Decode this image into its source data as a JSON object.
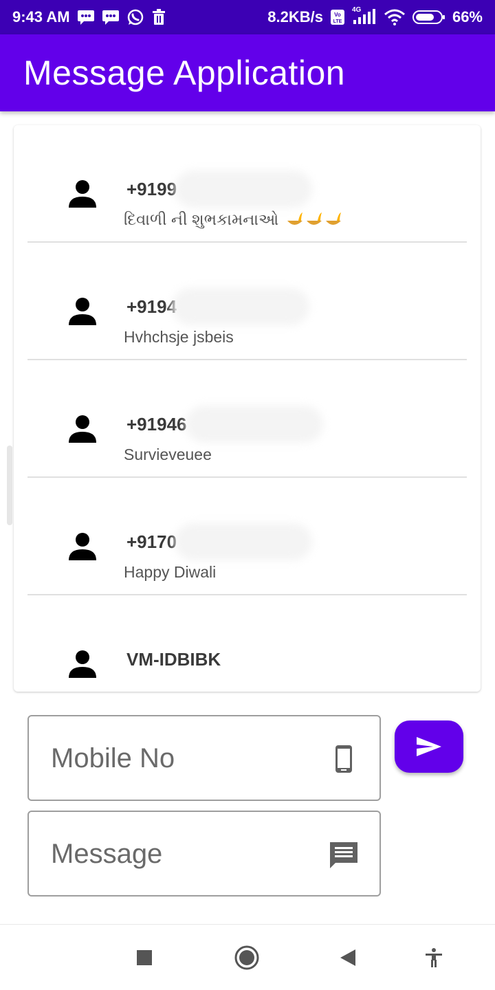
{
  "status_bar": {
    "time": "9:43 AM",
    "speed": "8.2KB/s",
    "network": "4G",
    "battery": "66%",
    "icons": [
      "message-icon",
      "message-icon",
      "whatsapp-icon",
      "trash-icon",
      "volte-icon",
      "signal-icon",
      "wifi-icon",
      "battery-icon"
    ]
  },
  "app_bar": {
    "title": "Message Application"
  },
  "messages": [
    {
      "sender": "+9199",
      "preview": "દિવાળી ની શુભકામનાઓ"
    },
    {
      "sender": "+9194",
      "preview": "Hvhchsje jsbeis"
    },
    {
      "sender": "+91946",
      "preview": "Survieveuee"
    },
    {
      "sender": "+9170",
      "preview": "Happy Diwali"
    },
    {
      "sender": "VM-IDBIBK",
      "preview": ""
    }
  ],
  "form": {
    "mobile_placeholder": "Mobile No",
    "message_placeholder": "Message"
  },
  "colors": {
    "primary": "#6200ea",
    "status_bar": "#3c00b4"
  },
  "nav_icons": [
    "recent-apps-icon",
    "home-icon",
    "back-icon",
    "accessibility-icon"
  ]
}
